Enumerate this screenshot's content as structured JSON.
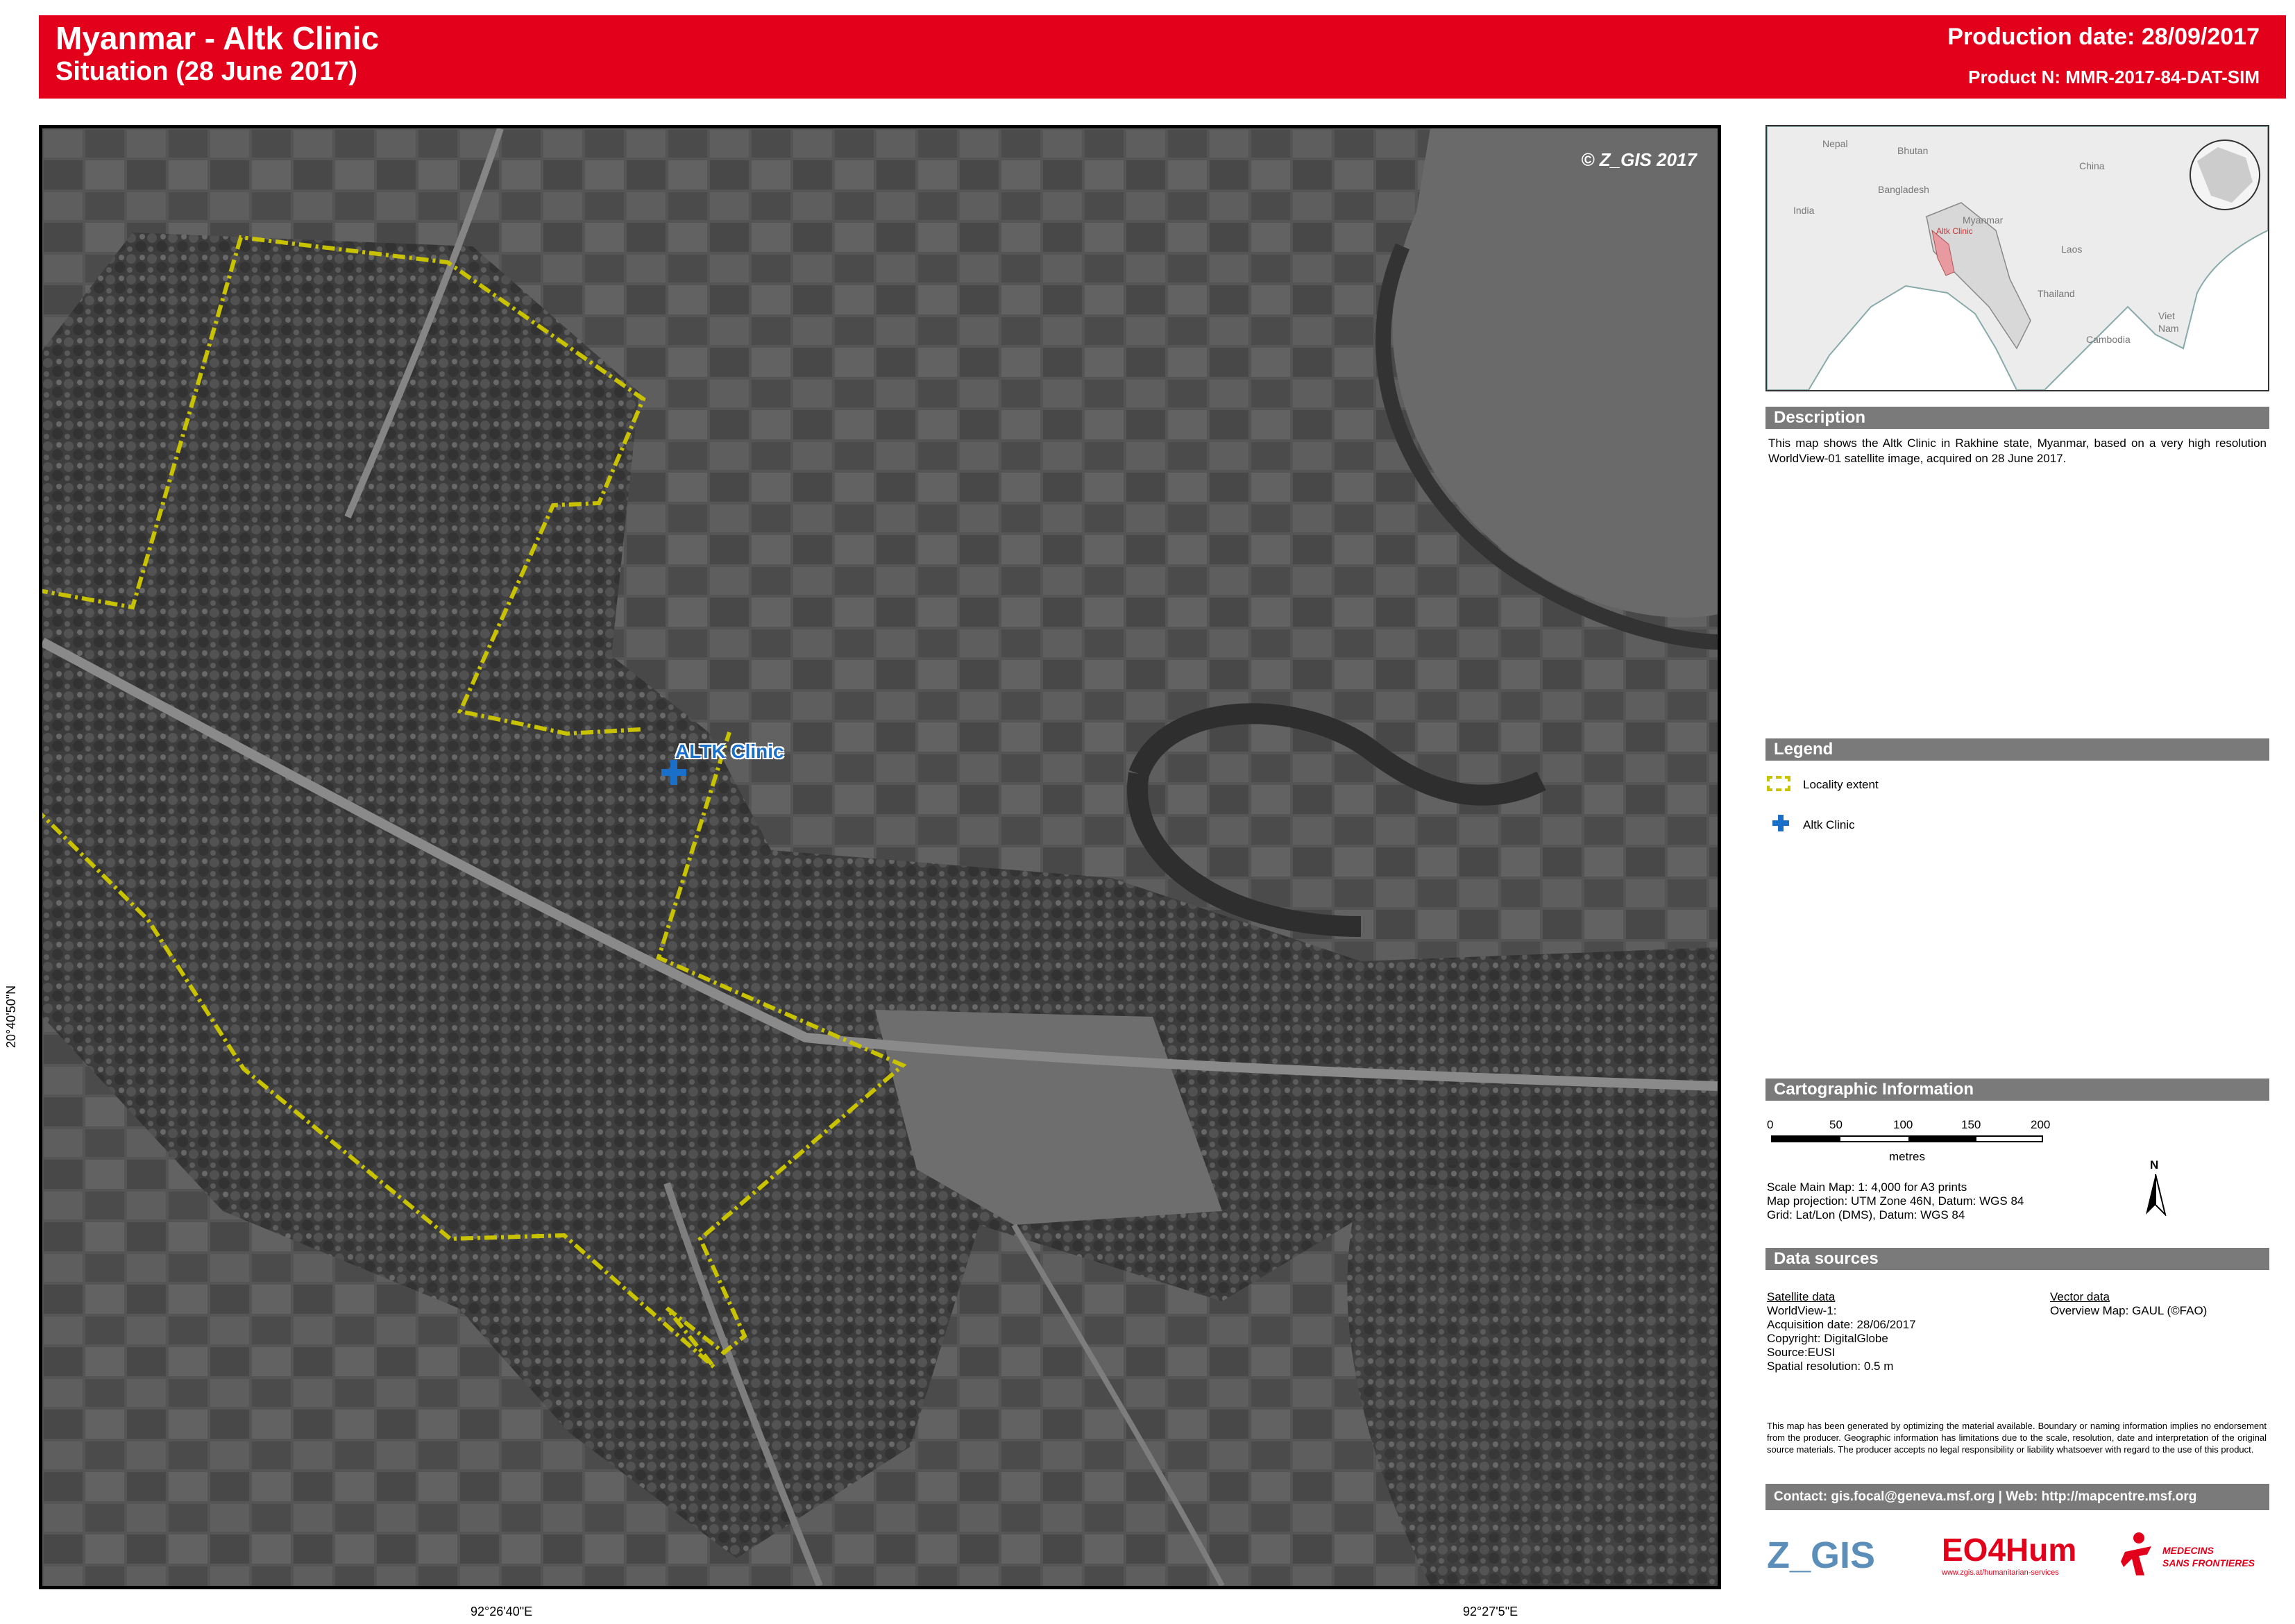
{
  "header": {
    "title": "Myanmar - Altk Clinic",
    "subtitle": "Situation (28 June 2017)",
    "production_date": "Production date: 28/09/2017",
    "product_number": "Product N: MMR-2017-84-DAT-SIM"
  },
  "map": {
    "copyright": "© Z_GIS 2017",
    "clinic_label": "ALTK Clinic",
    "coords": {
      "left_lat": "20°40'50\"N",
      "bottom_lon_1": "92°26'40\"E",
      "bottom_lon_2": "92°27'5\"E"
    }
  },
  "overview": {
    "labels": {
      "nepal": "Nepal",
      "bhutan": "Bhutan",
      "china": "China",
      "india": "India",
      "bangladesh": "Bangladesh",
      "myanmar": "Myanmar",
      "laos": "Laos",
      "thailand": "Thailand",
      "vietnam_1": "Viet",
      "vietnam_2": "Nam",
      "cambodia": "Cambodia",
      "clinic": "Altk Clinic"
    }
  },
  "description": {
    "heading": "Description",
    "text": "This map shows the Altk Clinic in Rakhine state, Myanmar, based on a very high resolution WorldView-01 satellite image, acquired on 28 June 2017."
  },
  "legend": {
    "heading": "Legend",
    "items": [
      {
        "label": "Locality extent",
        "icon": "locality-extent-icon"
      },
      {
        "label": "Altk Clinic",
        "icon": "clinic-cross-icon"
      }
    ]
  },
  "cartographic": {
    "heading": "Cartographic Information",
    "scale_ticks": [
      "0",
      "50",
      "100",
      "150",
      "200"
    ],
    "scale_unit": "metres",
    "scale_text": "Scale Main Map: 1: 4,000 for A3 prints",
    "projection": "Map projection: UTM Zone 46N, Datum: WGS 84",
    "grid": "Grid: Lat/Lon (DMS), Datum: WGS 84",
    "north": "N"
  },
  "data_sources": {
    "heading": "Data sources",
    "satellite_heading": "Satellite data",
    "satellite_lines": [
      "WorldView-1:",
      "Acquisition date: 28/06/2017",
      "Copyright: DigitalGlobe",
      "Source:EUSI",
      "Spatial resolution: 0.5 m"
    ],
    "vector_heading": "Vector data",
    "vector_lines": [
      "Overview Map: GAUL (©FAO)"
    ]
  },
  "disclaimer": "This map has been generated by optimizing the material available. Boundary or naming information implies no endorsement from the producer. Geographic information has limitations due to the scale, resolution, date and interpretation of the original source materials. The producer accepts no legal responsibility or liability whatsoever with regard to the use of this product.",
  "contact": "Contact: gis.focal@geneva.msf.org | Web: http://mapcentre.msf.org",
  "logos": {
    "zgis": "Z_GIS",
    "eo4hum": "EO4Hum",
    "eo4hum_url": "www.zgis.at/humanitarian-services",
    "msf_1": "MEDECINS",
    "msf_2": "SANS FRONTIERES"
  },
  "colors": {
    "header_red": "#e2001a",
    "locality_yellow": "#c8c200",
    "clinic_blue": "#1a6fc9",
    "section_grey": "#7a7a7a"
  }
}
